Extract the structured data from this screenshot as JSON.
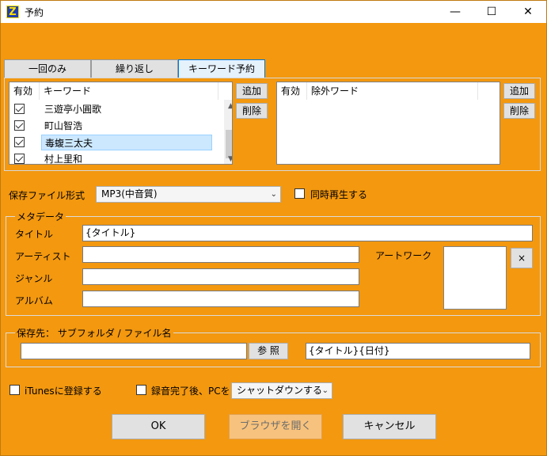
{
  "window": {
    "title": "予約",
    "app_icon_glyph": "Z",
    "min_glyph": "—",
    "max_glyph": "☐",
    "close_glyph": "✕"
  },
  "tabs": [
    {
      "label": "一回のみ",
      "active": false
    },
    {
      "label": "繰り返し",
      "active": false
    },
    {
      "label": "キーワード予約",
      "active": true
    }
  ],
  "keyword_list": {
    "col_enabled": "有効",
    "col_keyword": "キーワード",
    "rows": [
      {
        "checked": true,
        "text": "三遊亭小圓歌",
        "selected": false
      },
      {
        "checked": true,
        "text": "町山智浩",
        "selected": false
      },
      {
        "checked": true,
        "text": "毒蝮三太夫",
        "selected": true
      },
      {
        "checked": true,
        "text": "村上里和",
        "selected": false
      }
    ],
    "add_label": "追加",
    "delete_label": "削除"
  },
  "exclude_list": {
    "col_enabled": "有効",
    "col_exclude": "除外ワード",
    "add_label": "追加",
    "delete_label": "削除"
  },
  "save_format": {
    "label": "保存ファイル形式",
    "value": "MP3(中音質)",
    "simultaneous_label": "同時再生する",
    "simultaneous_checked": false
  },
  "metadata": {
    "group_label": "メタデータ",
    "title_label": "タイトル",
    "title_value": "{タイトル}",
    "artist_label": "アーティスト",
    "artist_value": "",
    "genre_label": "ジャンル",
    "genre_value": "",
    "album_label": "アルバム",
    "album_value": "",
    "artwork_label": "アートワーク",
    "artwork_clear": "×"
  },
  "save_dest": {
    "group_label": "保存先： サブフォルダ / ファイル名",
    "folder_value": "",
    "browse_label": "参 照",
    "filename_value": "{タイトル}{日付}"
  },
  "itunes": {
    "label": "iTunesに登録する",
    "checked": false
  },
  "after_record": {
    "label": "録音完了後、PCを",
    "checked": false,
    "value": "シャットダウンする"
  },
  "buttons": {
    "ok": "OK",
    "browser": "ブラウザを開く",
    "cancel": "キャンセル"
  },
  "colors": {
    "background": "#f3980f",
    "selection": "#cce8ff"
  }
}
